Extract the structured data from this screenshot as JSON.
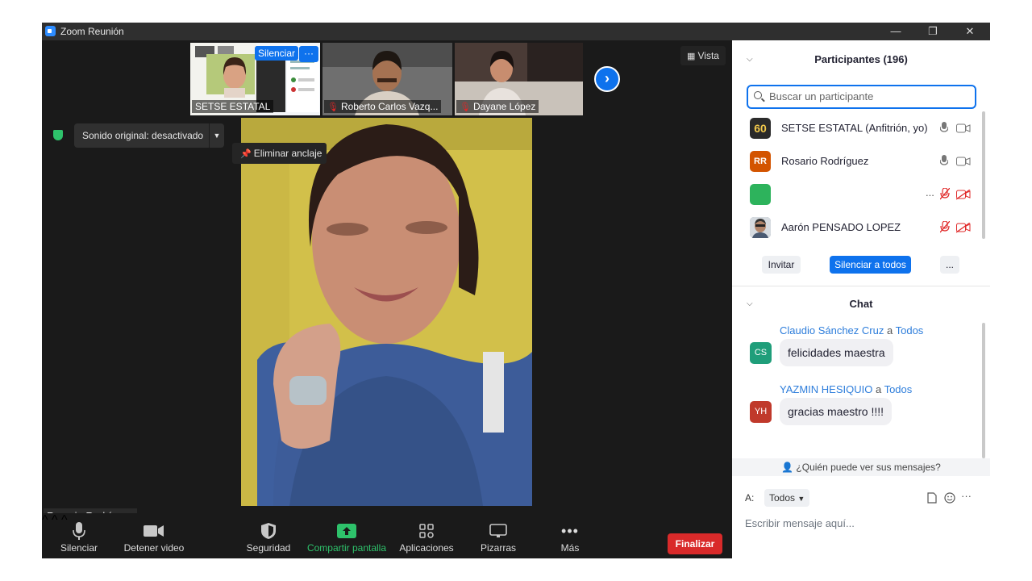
{
  "window": {
    "title": "Zoom Reunión",
    "minimize": "—",
    "restore": "❐",
    "close": "✕"
  },
  "thumbnails": [
    {
      "name": "SETSE ESTATAL",
      "muted": false,
      "mute_button": "Silenciar",
      "more_button": "···"
    },
    {
      "name": "Roberto Carlos Vazq...",
      "muted": true
    },
    {
      "name": "Dayane López",
      "muted": true
    }
  ],
  "vista_label": "Vista",
  "sound": {
    "label": "Sonido original: desactivado"
  },
  "unpin_label": "Eliminar anclaje",
  "speaker_name": "Rosario Rodríguez",
  "toolbar": {
    "mute": "Silenciar",
    "video": "Detener video",
    "security": "Seguridad",
    "share": "Compartir pantalla",
    "apps": "Aplicaciones",
    "whiteboards": "Pizarras",
    "more": "Más",
    "end": "Finalizar"
  },
  "participants": {
    "title": "Participantes (196)",
    "search_placeholder": "Buscar un participante",
    "items": [
      {
        "name": "SETSE ESTATAL (Anfitrión, yo)",
        "avatar": "60",
        "color": "#2a2a2a"
      },
      {
        "name": "Rosario Rodríguez",
        "avatar": "RR",
        "color": "#d35400"
      },
      {
        "name": "",
        "avatar": "",
        "color": "#2db35c"
      },
      {
        "name": "Aarón PENSADO LOPEZ",
        "avatar": "",
        "color": "#8a9aa8"
      }
    ],
    "invite": "Invitar",
    "mute_all": "Silenciar a todos",
    "more": "..."
  },
  "chat": {
    "title": "Chat",
    "connector": "a",
    "messages": [
      {
        "sender": "Claudio Sánchez Cruz",
        "recipient": "Todos",
        "initials": "CS",
        "color": "#1f9e7a",
        "text": "felicidades maestra"
      },
      {
        "sender": "YAZMIN HESIQUIO",
        "recipient": "Todos",
        "initials": "YH",
        "color": "#c0392b",
        "text": "gracias maestro !!!!"
      }
    ],
    "who_sees": "¿Quién puede ver sus mensajes?",
    "to_label": "A:",
    "to_value": "Todos",
    "input_placeholder": "Escribir mensaje aquí..."
  }
}
